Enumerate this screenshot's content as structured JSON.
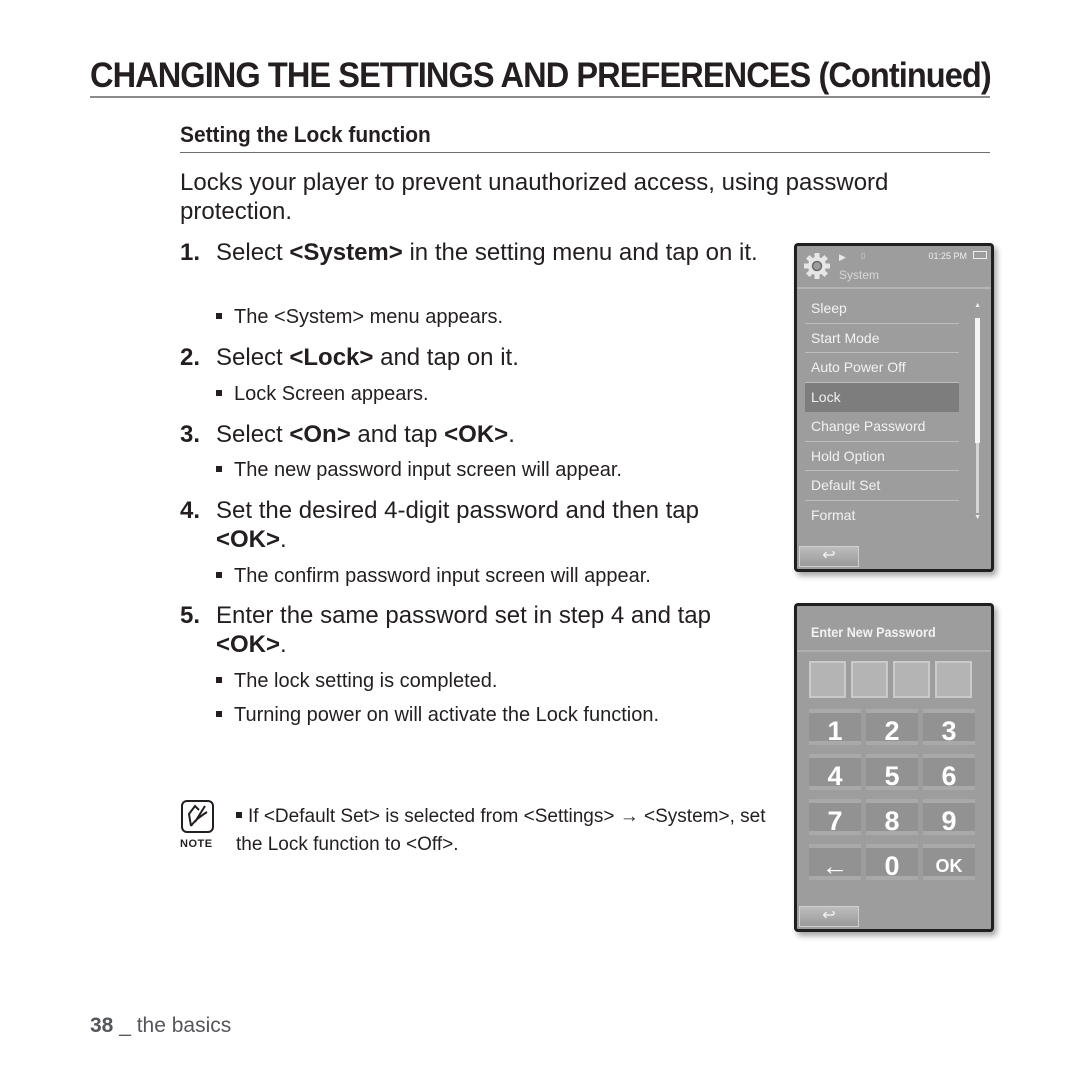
{
  "page": {
    "title": "CHANGING THE SETTINGS AND PREFERENCES (Continued)",
    "section_title": "Setting the Lock function",
    "intro": "Locks your player to prevent unauthorized access, using password protection.",
    "steps": [
      {
        "num": "1.",
        "pre": "Select ",
        "bold": "<System>",
        "post": " in the setting menu and tap on it.",
        "bullets": [
          "The <System> menu appears."
        ]
      },
      {
        "num": "2.",
        "pre": "Select ",
        "bold": "<Lock>",
        "post": " and tap on it.",
        "bullets": [
          "Lock Screen appears."
        ]
      },
      {
        "num": "3.",
        "pre": "Select ",
        "bold": "<On>",
        "mid": " and tap ",
        "bold2": "<OK>",
        "post": ".",
        "bullets": [
          "The new password input screen will appear."
        ]
      },
      {
        "num": "4.",
        "pre": "Set the desired 4-digit password and then tap ",
        "bold": "<OK>",
        "post": ".",
        "bullets": [
          "The confirm password input screen will appear."
        ]
      },
      {
        "num": "5.",
        "pre": "Enter the same password set in step 4 and tap ",
        "bold": "<OK>",
        "post": ".",
        "bullets": [
          "The lock setting is completed.",
          "Turning power on will activate the Lock function."
        ]
      }
    ],
    "note": {
      "label": "NOTE",
      "icon": "note-pencil-icon",
      "text": "If <Default Set> is selected from <Settings> → <System>, set the Lock function to <Off>."
    },
    "footer": {
      "page_number": "38",
      "separator": " _ ",
      "section": "the basics"
    }
  },
  "device_system_menu": {
    "status": {
      "time": "01:25 PM",
      "icons": [
        "gear-icon",
        "play-icon",
        "card-icon",
        "battery-icon"
      ]
    },
    "title": "System",
    "items": [
      "Sleep",
      "Start Mode",
      "Auto Power Off",
      "Lock",
      "Change Password",
      "Hold Option",
      "Default Set",
      "Format"
    ],
    "selected": "Lock",
    "back_icon": "↩"
  },
  "device_password": {
    "title": "Enter New Password",
    "digits_count": 4,
    "keys": [
      "1",
      "2",
      "3",
      "4",
      "5",
      "6",
      "7",
      "8",
      "9",
      "←",
      "0",
      "OK"
    ],
    "back_icon": "↩"
  }
}
